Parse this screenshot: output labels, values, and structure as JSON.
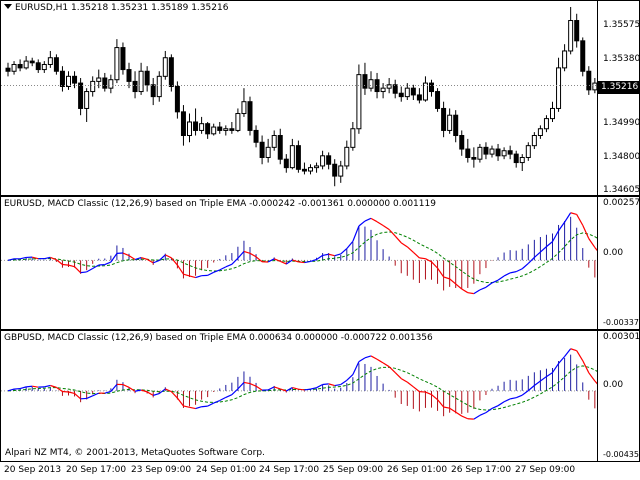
{
  "main_chart": {
    "title": "EURUSD,H1  1.35218 1.35231 1.35189 1.35216",
    "price_labels": [
      "1.35575",
      "1.35380",
      "1.34990",
      "1.34800",
      "1.34605"
    ],
    "current_price": "1.35216",
    "candle_color": "#000000",
    "background": "#ffffff"
  },
  "indicator1": {
    "title": "EURUSD, MACD Classic (12,26,9) based on Triple EMA -0.000242 -0.001361 0.000000 0.001119",
    "labels": [
      "0.002573",
      "0.00",
      "-0.003373"
    ],
    "histogram_up_color": "#1c1ca0",
    "histogram_down_color": "#b0101a",
    "macd_up_color": "#0000ff",
    "macd_down_color": "#ff0000",
    "signal_color": "#008000"
  },
  "indicator2": {
    "title": "GBPUSD, MACD Classic (12,26,9) based on Triple EMA 0.000634 0.000000 -0.000722 0.001356",
    "labels": [
      "0.003019",
      "0.00",
      "-0.004354"
    ],
    "copyright": "Alpari NZ MT4, © 2001-2013, MetaQuotes Software Corp."
  },
  "time_axis": {
    "labels": [
      "20 Sep 2013",
      "20 Sep 17:00",
      "23 Sep 09:00",
      "24 Sep 01:00",
      "24 Sep 17:00",
      "25 Sep 09:00",
      "26 Sep 01:00",
      "26 Sep 17:00",
      "27 Sep 09:00"
    ]
  },
  "chart_data": {
    "type": "candlestick",
    "symbol": "EURUSD",
    "timeframe": "H1",
    "ylim": [
      1.3458,
      1.3568
    ],
    "ohlc": [
      [
        1.35318,
        1.3535,
        1.3527,
        1.353
      ],
      [
        1.353,
        1.3536,
        1.3528,
        1.3534
      ],
      [
        1.3534,
        1.3537,
        1.353,
        1.3532
      ],
      [
        1.3532,
        1.3539,
        1.3531,
        1.3536
      ],
      [
        1.3536,
        1.3538,
        1.3533,
        1.3535
      ],
      [
        1.3535,
        1.3537,
        1.3529,
        1.3531
      ],
      [
        1.3531,
        1.3536,
        1.3529,
        1.3534
      ],
      [
        1.3534,
        1.3542,
        1.3532,
        1.3538
      ],
      [
        1.3538,
        1.354,
        1.3528,
        1.353
      ],
      [
        1.353,
        1.3533,
        1.3518,
        1.3521
      ],
      [
        1.3521,
        1.353,
        1.3519,
        1.3527
      ],
      [
        1.3527,
        1.353,
        1.352,
        1.3523
      ],
      [
        1.3523,
        1.3526,
        1.3504,
        1.3508
      ],
      [
        1.3508,
        1.352,
        1.35,
        1.3518
      ],
      [
        1.3518,
        1.3527,
        1.3515,
        1.3524
      ],
      [
        1.3524,
        1.3531,
        1.352,
        1.3526
      ],
      [
        1.3526,
        1.3529,
        1.3518,
        1.352
      ],
      [
        1.352,
        1.3528,
        1.3517,
        1.3525
      ],
      [
        1.3525,
        1.3549,
        1.3523,
        1.3544
      ],
      [
        1.3544,
        1.3547,
        1.3528,
        1.3531
      ],
      [
        1.3531,
        1.3535,
        1.352,
        1.3524
      ],
      [
        1.3524,
        1.353,
        1.3514,
        1.3518
      ],
      [
        1.3518,
        1.3535,
        1.3516,
        1.353
      ],
      [
        1.353,
        1.3533,
        1.3518,
        1.3522
      ],
      [
        1.3522,
        1.3526,
        1.351,
        1.3515
      ],
      [
        1.3515,
        1.353,
        1.3512,
        1.3527
      ],
      [
        1.3527,
        1.3542,
        1.3525,
        1.3538
      ],
      [
        1.3538,
        1.354,
        1.3518,
        1.3521
      ],
      [
        1.3521,
        1.3524,
        1.3502,
        1.3506
      ],
      [
        1.3506,
        1.351,
        1.3486,
        1.3492
      ],
      [
        1.3492,
        1.3505,
        1.3488,
        1.35
      ],
      [
        1.35,
        1.3508,
        1.3492,
        1.3495
      ],
      [
        1.3495,
        1.3503,
        1.3493,
        1.3499
      ],
      [
        1.3499,
        1.35,
        1.349,
        1.3493
      ],
      [
        1.3493,
        1.3499,
        1.3492,
        1.3497
      ],
      [
        1.3497,
        1.35,
        1.3493,
        1.3495
      ],
      [
        1.3495,
        1.3498,
        1.3492,
        1.3496
      ],
      [
        1.3496,
        1.35,
        1.3493,
        1.3495
      ],
      [
        1.3495,
        1.3508,
        1.3494,
        1.3505
      ],
      [
        1.3505,
        1.352,
        1.3503,
        1.3512
      ],
      [
        1.3512,
        1.3515,
        1.3492,
        1.3495
      ],
      [
        1.3495,
        1.3498,
        1.3485,
        1.3488
      ],
      [
        1.3488,
        1.3492,
        1.3475,
        1.3479
      ],
      [
        1.3479,
        1.349,
        1.3476,
        1.3485
      ],
      [
        1.3485,
        1.3495,
        1.3483,
        1.3492
      ],
      [
        1.3492,
        1.3496,
        1.3475,
        1.3478
      ],
      [
        1.3478,
        1.3481,
        1.347,
        1.3473
      ],
      [
        1.3473,
        1.349,
        1.3472,
        1.3486
      ],
      [
        1.3486,
        1.3489,
        1.347,
        1.3472
      ],
      [
        1.3472,
        1.3476,
        1.3469,
        1.3471
      ],
      [
        1.3471,
        1.3475,
        1.3469,
        1.3473
      ],
      [
        1.3473,
        1.3476,
        1.347,
        1.3474
      ],
      [
        1.3474,
        1.3483,
        1.3472,
        1.348
      ],
      [
        1.348,
        1.3482,
        1.3472,
        1.3475
      ],
      [
        1.3475,
        1.3478,
        1.3462,
        1.3468
      ],
      [
        1.3468,
        1.3477,
        1.3464,
        1.3474
      ],
      [
        1.3474,
        1.3489,
        1.3472,
        1.3485
      ],
      [
        1.3485,
        1.35,
        1.3483,
        1.3496
      ],
      [
        1.3496,
        1.3534,
        1.3493,
        1.3528
      ],
      [
        1.3528,
        1.3535,
        1.3516,
        1.352
      ],
      [
        1.352,
        1.353,
        1.3518,
        1.3525
      ],
      [
        1.3525,
        1.3529,
        1.3514,
        1.3518
      ],
      [
        1.3518,
        1.3523,
        1.3514,
        1.352
      ],
      [
        1.352,
        1.3526,
        1.3517,
        1.3522
      ],
      [
        1.3522,
        1.3525,
        1.3514,
        1.3517
      ],
      [
        1.3517,
        1.3521,
        1.3512,
        1.3515
      ],
      [
        1.3515,
        1.3523,
        1.3513,
        1.352
      ],
      [
        1.352,
        1.3522,
        1.3513,
        1.3516
      ],
      [
        1.3516,
        1.352,
        1.3511,
        1.3513
      ],
      [
        1.3513,
        1.3527,
        1.3512,
        1.3523
      ],
      [
        1.3523,
        1.3525,
        1.3515,
        1.3518
      ],
      [
        1.3518,
        1.352,
        1.3506,
        1.3508
      ],
      [
        1.3508,
        1.3512,
        1.3491,
        1.3495
      ],
      [
        1.3495,
        1.3508,
        1.3493,
        1.3504
      ],
      [
        1.3504,
        1.3507,
        1.3488,
        1.3492
      ],
      [
        1.3492,
        1.3495,
        1.348,
        1.3484
      ],
      [
        1.3484,
        1.349,
        1.3476,
        1.3479
      ],
      [
        1.3479,
        1.3485,
        1.3473,
        1.3478
      ],
      [
        1.3478,
        1.3487,
        1.3476,
        1.3485
      ],
      [
        1.3485,
        1.3488,
        1.3478,
        1.3481
      ],
      [
        1.3481,
        1.3486,
        1.3479,
        1.3484
      ],
      [
        1.3484,
        1.3487,
        1.3477,
        1.348
      ],
      [
        1.348,
        1.3485,
        1.3478,
        1.3483
      ],
      [
        1.3483,
        1.3486,
        1.3478,
        1.3481
      ],
      [
        1.3481,
        1.3483,
        1.3473,
        1.3476
      ],
      [
        1.3476,
        1.3481,
        1.3471,
        1.3479
      ],
      [
        1.3479,
        1.3488,
        1.3477,
        1.3486
      ],
      [
        1.3486,
        1.3494,
        1.3484,
        1.3492
      ],
      [
        1.3492,
        1.3498,
        1.349,
        1.3496
      ],
      [
        1.3496,
        1.3504,
        1.3494,
        1.3502
      ],
      [
        1.3502,
        1.3512,
        1.35,
        1.3508
      ],
      [
        1.3508,
        1.3538,
        1.3506,
        1.3532
      ],
      [
        1.3532,
        1.3546,
        1.353,
        1.3542
      ],
      [
        1.3542,
        1.3568,
        1.354,
        1.356
      ],
      [
        1.356,
        1.3564,
        1.3544,
        1.3548
      ],
      [
        1.3548,
        1.355,
        1.3527,
        1.353
      ],
      [
        1.353,
        1.3533,
        1.3516,
        1.3519
      ],
      [
        1.3519,
        1.3526,
        1.3517,
        1.3523
      ],
      [
        1.35218,
        1.35231,
        1.35189,
        1.35216
      ]
    ]
  }
}
